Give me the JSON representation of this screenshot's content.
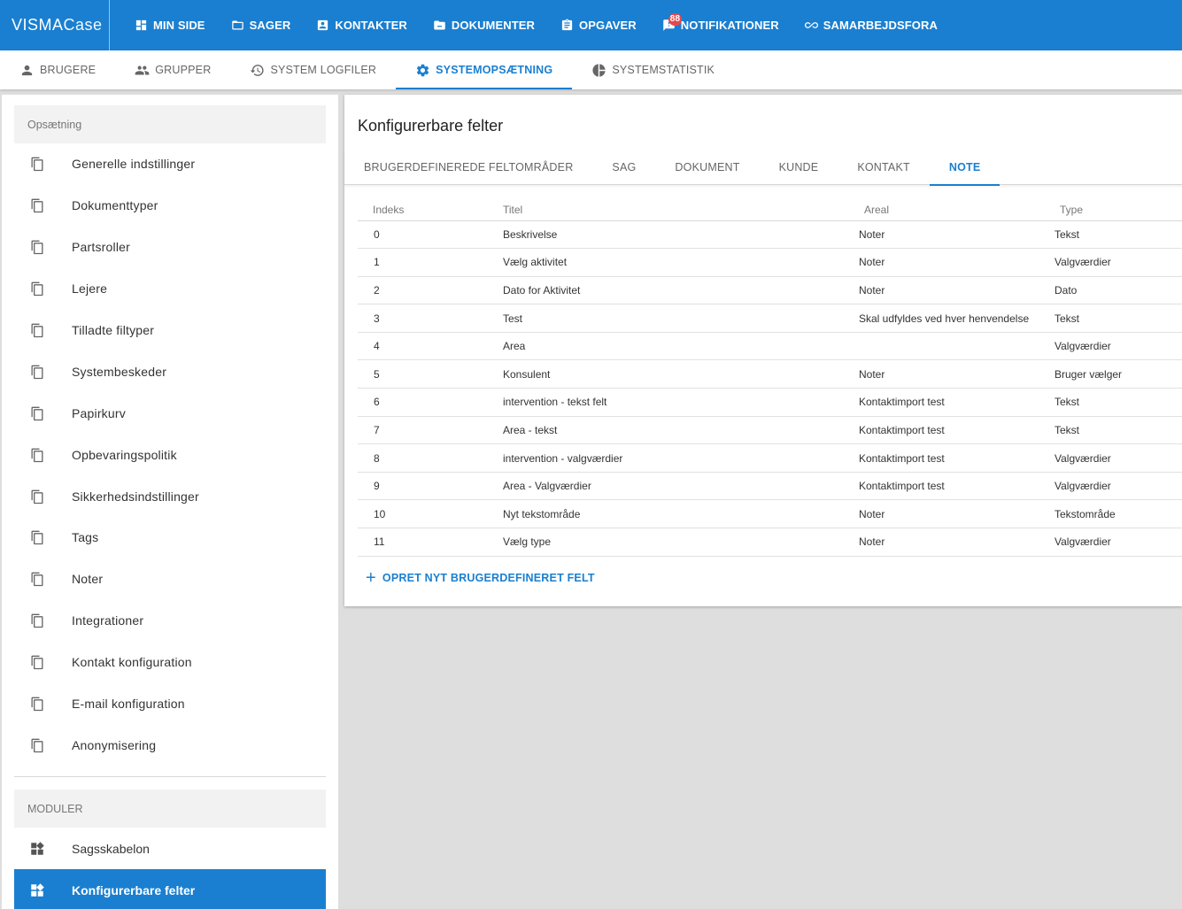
{
  "app": {
    "logo_visma": "VISMA",
    "logo_case": "Case"
  },
  "topnav": [
    {
      "label": "MIN SIDE",
      "icon": "dashboard-icon"
    },
    {
      "label": "SAGER",
      "icon": "folder-icon"
    },
    {
      "label": "KONTAKTER",
      "icon": "contact-icon"
    },
    {
      "label": "DOKUMENTER",
      "icon": "document-folder-icon"
    },
    {
      "label": "OPGAVER",
      "icon": "clipboard-icon"
    },
    {
      "label": "NOTIFIKATIONER",
      "icon": "chat-notification-icon",
      "badge": "88"
    },
    {
      "label": "SAMARBEJDSFORA",
      "icon": "link-icon"
    }
  ],
  "subnav": [
    {
      "label": "BRUGERE",
      "icon": "person-icon"
    },
    {
      "label": "GRUPPER",
      "icon": "group-icon"
    },
    {
      "label": "SYSTEM LOGFILER",
      "icon": "history-icon"
    },
    {
      "label": "SYSTEMOPSÆTNING",
      "icon": "gear-icon",
      "active": true
    },
    {
      "label": "SYSTEMSTATISTIK",
      "icon": "pie-chart-icon"
    }
  ],
  "sidebar": {
    "setup_header": "Opsætning",
    "setup_items": [
      "Generelle indstillinger",
      "Dokumenttyper",
      "Partsroller",
      "Lejere",
      "Tilladte filtyper",
      "Systembeskeder",
      "Papirkurv",
      "Opbevaringspolitik",
      "Sikkerhedsindstillinger",
      "Tags",
      "Noter",
      "Integrationer",
      "Kontakt konfiguration",
      "E-mail konfiguration",
      "Anonymisering"
    ],
    "modules_header": "MODULER",
    "module_items": [
      "Sagsskabelon",
      "Konfigurerbare felter"
    ]
  },
  "main": {
    "title": "Konfigurerbare felter",
    "tabs": [
      "BRUGERDEFINEREDE FELTOMRÅDER",
      "SAG",
      "DOKUMENT",
      "KUNDE",
      "KONTAKT",
      "NOTE"
    ],
    "active_tab": "NOTE",
    "columns": [
      "Indeks",
      "Titel",
      "Areal",
      "Type"
    ],
    "rows": [
      [
        "0",
        "Beskrivelse",
        "Noter",
        "Tekst"
      ],
      [
        "1",
        "Vælg aktivitet",
        "Noter",
        "Valgværdier"
      ],
      [
        "2",
        "Dato for Aktivitet",
        "Noter",
        "Dato"
      ],
      [
        "3",
        "Test",
        "Skal udfyldes ved hver henvendelse",
        "Tekst"
      ],
      [
        "4",
        "Area",
        "",
        "Valgværdier"
      ],
      [
        "5",
        "Konsulent",
        "Noter",
        "Bruger vælger"
      ],
      [
        "6",
        "intervention - tekst felt",
        "Kontaktimport test",
        "Tekst"
      ],
      [
        "7",
        "Area - tekst",
        "Kontaktimport test",
        "Tekst"
      ],
      [
        "8",
        "intervention - valgværdier",
        "Kontaktimport test",
        "Valgværdier"
      ],
      [
        "9",
        "Area - Valgværdier",
        "Kontaktimport test",
        "Valgværdier"
      ],
      [
        "10",
        "Nyt tekstområde",
        "Noter",
        "Tekstområde"
      ],
      [
        "11",
        "Vælg type",
        "Noter",
        "Valgværdier"
      ]
    ],
    "add_button": "OPRET NYT BRUGERDEFINERET FELT"
  },
  "colors": {
    "primary": "#1a7fd0",
    "badge": "#e5484d"
  }
}
